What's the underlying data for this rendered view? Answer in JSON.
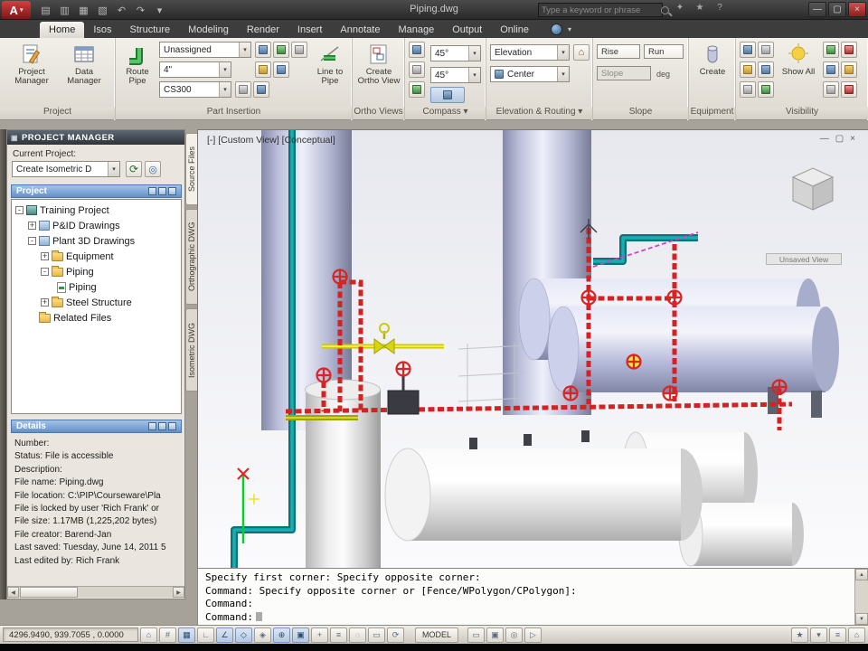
{
  "titlebar": {
    "title": "Piping.dwg",
    "search_placeholder": "Type a keyword or phrase"
  },
  "icons": {
    "logo": "A",
    "new": "▤",
    "open": "▥",
    "save": "▦",
    "plot": "▧",
    "undo": "↶",
    "redo": "↷",
    "dropdown": "▾",
    "minimize": "—",
    "maximize": "▢",
    "close": "×",
    "help": "?",
    "star": "★",
    "signal": "✦",
    "refresh": "⟳",
    "sync": "◎",
    "home": "⌂",
    "up": "▲",
    "down": "▼",
    "left": "◀",
    "right": "▶",
    "palette": "▣",
    "workspace_dd": "▾"
  },
  "tabs": {
    "items": [
      "Home",
      "Isos",
      "Structure",
      "Modeling",
      "Render",
      "Insert",
      "Annotate",
      "Manage",
      "Output",
      "Online"
    ]
  },
  "ribbon": {
    "panel_labels": [
      "Project",
      "Part Insertion",
      "Ortho Views",
      "Compass ▾",
      "Elevation & Routing ▾",
      "Slope",
      "Equipment",
      "Visibility"
    ],
    "project": {
      "project_manager": "Project Manager",
      "data_manager": "Data Manager"
    },
    "part_insertion": {
      "route_pipe": "Route Pipe",
      "spec": "Unassigned",
      "size": "4\"",
      "line_number": "CS300",
      "line_to_pipe": "Line to Pipe"
    },
    "ortho": {
      "create_ortho": "Create Ortho View"
    },
    "compass": {
      "angle1": "45°",
      "angle2": "45°"
    },
    "elevation": {
      "elevation": "Elevation",
      "center": "Center"
    },
    "slope": {
      "rise": "Rise",
      "run": "Run",
      "slope": "Slope",
      "deg": "deg"
    },
    "equipment": {
      "create": "Create"
    },
    "visibility": {
      "show_all": "Show All"
    }
  },
  "project_manager": {
    "title": "PROJECT MANAGER",
    "current_project_label": "Current Project:",
    "current_project_value": "Create Isometric D",
    "project_section": "Project",
    "tree": [
      {
        "toggle": "-",
        "label": "Training Project"
      },
      {
        "toggle": "+",
        "label": "P&ID Drawings"
      },
      {
        "toggle": "-",
        "label": "Plant 3D Drawings"
      },
      {
        "toggle": "+",
        "label": "Equipment"
      },
      {
        "toggle": "-",
        "label": "Piping"
      },
      {
        "label": "Piping"
      },
      {
        "toggle": "+",
        "label": "Steel Structure"
      },
      {
        "label": "Related Files"
      }
    ],
    "side_tabs": [
      "Source Files",
      "Orthographic DWG",
      "Isometric DWG"
    ],
    "details_title": "Details",
    "details": [
      "Number:",
      "Status: File is accessible",
      "Description:",
      "File name: Piping.dwg",
      "File location: C:\\PIP\\Courseware\\Pla",
      "File is locked by user 'Rich Frank' or",
      "File size: 1.17MB (1,225,202 bytes)",
      "File creator: Barend-Jan",
      "Last saved: Tuesday, June 14, 2011 5",
      "Last edited by: Rich Frank"
    ]
  },
  "viewport": {
    "view_label": "[-] [Custom View] [Conceptual]",
    "unsaved_view": "Unsaved View"
  },
  "command": {
    "lines": [
      "Specify first corner: Specify opposite corner:",
      "Command: Specify opposite corner or [Fence/WPolygon/CPolygon]:",
      "Command:",
      "Command:"
    ]
  },
  "status": {
    "coordinates": "4296.9490, 939.7055 , 0.0000",
    "model": "MODEL",
    "toggles": [
      "⌂",
      "#",
      "▦",
      "∟",
      "∠",
      "◇",
      "◈",
      "⊕",
      "▣",
      "+",
      "≡",
      "◌",
      "▭",
      "⟳"
    ],
    "right": [
      "▭",
      "▣",
      "◎",
      "▷",
      "★",
      "▾",
      "≡",
      "⌂"
    ]
  }
}
